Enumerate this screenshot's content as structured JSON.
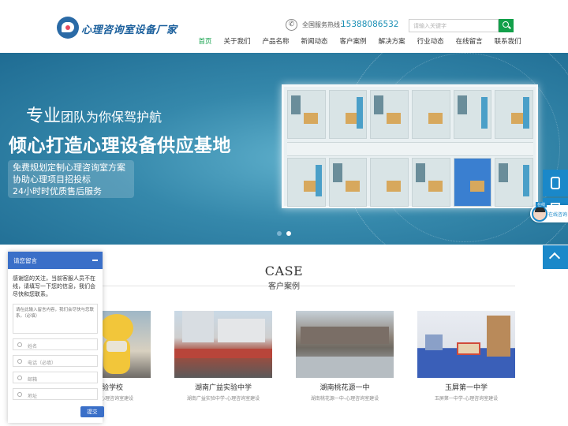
{
  "header": {
    "logo_text": "心理咨询室设备厂家",
    "hotline_label": "全国服务热线：",
    "hotline_number": "15388086532",
    "search_placeholder": "请输入关键字"
  },
  "nav": [
    {
      "label": "首页",
      "active": true
    },
    {
      "label": "关于我们"
    },
    {
      "label": "产品名称"
    },
    {
      "label": "新闻动态"
    },
    {
      "label": "客户案例"
    },
    {
      "label": "解决方案"
    },
    {
      "label": "行业动态"
    },
    {
      "label": "在线留言"
    },
    {
      "label": "联系我们"
    }
  ],
  "banner": {
    "line1_highlight": "专业",
    "line1_rest": "团队为你保驾护航",
    "line2": "倾心打造心理设备供应基地",
    "services": [
      "免费规划定制心理咨询室方案",
      "协助心理项目招投标",
      "24小时时优质售后服务"
    ],
    "slides_total": 2,
    "slide_active": 2
  },
  "case_section": {
    "title_en": "CASE",
    "title_cn": "客户案例"
  },
  "cases": [
    {
      "title": "卓越实验学校",
      "desc": "卓越实验学校-心理咨询室建设"
    },
    {
      "title": "湖南广益实验中学",
      "desc": "湖南广益实验中学-心理咨询室建设"
    },
    {
      "title": "湖南桃花源一中",
      "desc": "湖南桃花源一中-心理咨询室建设"
    },
    {
      "title": "玉屏第一中学",
      "desc": "玉屏第一中学-心理咨询室建设"
    }
  ],
  "chat": {
    "title": "请您留言",
    "intro": "感谢您的关注，当前客服人员不在线，请填写一下您的信息，我们会尽快和您联系。",
    "message_placeholder": "请在此输入留言内容，我们会尽快与您联系。（必填）",
    "fields": [
      "姓名",
      "电话（必填）",
      "邮箱",
      "地址"
    ],
    "submit": "提交"
  },
  "online": {
    "badge": "在线",
    "label": "在线咨询"
  },
  "colors": {
    "brand_green": "#12a04a",
    "brand_blue": "#1a88c9",
    "chat_blue": "#3a6fc8"
  }
}
